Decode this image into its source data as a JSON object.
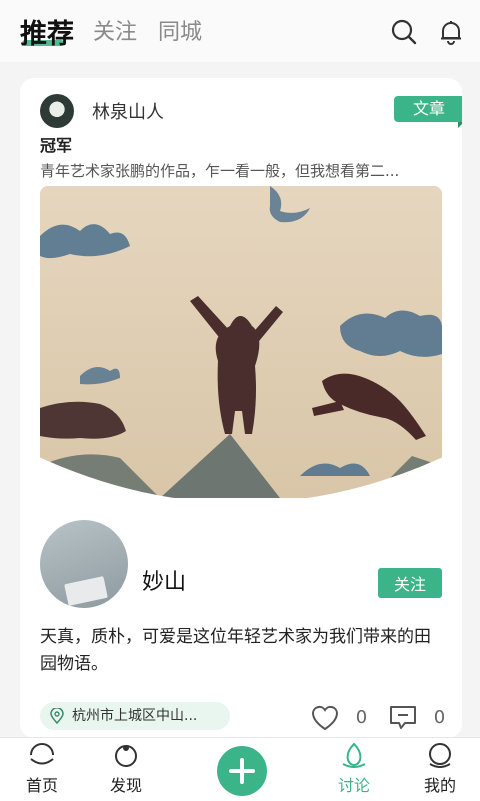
{
  "top_tabs": [
    {
      "label": "推荐",
      "active": true
    },
    {
      "label": "关注",
      "active": false
    },
    {
      "label": "同城",
      "active": false
    }
  ],
  "icons": {
    "search": "search-icon",
    "bell": "bell-icon"
  },
  "post": {
    "author": "林泉山人",
    "tag": "文章",
    "title": "冠军",
    "excerpt": "青年艺术家张鹏的作品，乍一看一般，但我想看第二...",
    "poster_name": "妙山",
    "follow_label": "关注",
    "body": "天真，质朴，可爱是这位年轻艺术家为我们带来的田园物语。",
    "location": "杭州市上城区中山...",
    "likes": "0",
    "comments": "0"
  },
  "bottom_nav": [
    {
      "label": "首页",
      "icon": "home-icon",
      "active": false
    },
    {
      "label": "发现",
      "icon": "discover-icon",
      "active": false
    },
    {
      "label": "讨论",
      "icon": "discussion-icon",
      "active": true
    },
    {
      "label": "我的",
      "icon": "profile-icon",
      "active": false
    }
  ],
  "colors": {
    "accent": "#3cb48a"
  }
}
